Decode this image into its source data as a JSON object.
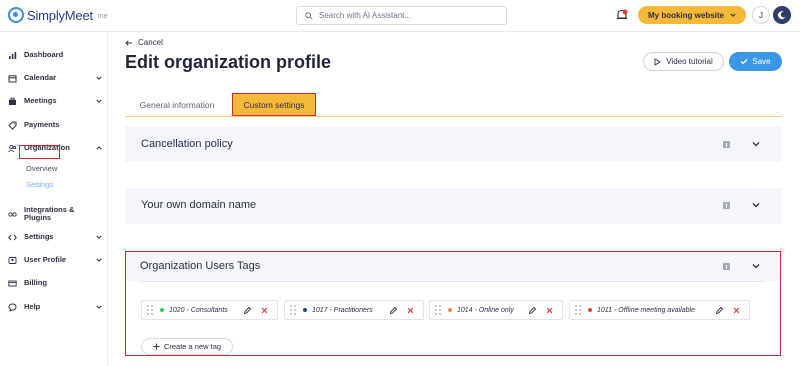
{
  "brand": {
    "name": "SimplyMeet",
    "suffix": "me"
  },
  "search": {
    "placeholder": "Search with AI Assistant..."
  },
  "header": {
    "booking_button": "My booking website",
    "avatar_initial": "J"
  },
  "sidebar": {
    "items": [
      {
        "label": "Dashboard",
        "icon": "chart-icon"
      },
      {
        "label": "Calendar",
        "icon": "calendar-icon"
      },
      {
        "label": "Meetings",
        "icon": "briefcase-icon"
      },
      {
        "label": "Payments",
        "icon": "tag-icon"
      },
      {
        "label": "Organization",
        "icon": "users-icon"
      },
      {
        "label": "Integrations & Plugins",
        "icon": "plug-icon"
      },
      {
        "label": "Settings",
        "icon": "code-icon"
      },
      {
        "label": "User Profile",
        "icon": "user-icon"
      },
      {
        "label": "Billing",
        "icon": "card-icon"
      },
      {
        "label": "Help",
        "icon": "chat-icon"
      }
    ],
    "organization_sub": [
      {
        "label": "Overview"
      },
      {
        "label": "Settings"
      }
    ]
  },
  "main": {
    "cancel_label": "Cancel",
    "title": "Edit organization profile",
    "video_tutorial_label": "Video tutorial",
    "save_label": "Save",
    "tabs": [
      {
        "label": "General information"
      },
      {
        "label": "Custom settings"
      }
    ],
    "panels": [
      {
        "title": "Cancellation policy"
      },
      {
        "title": "Your own domain name"
      },
      {
        "title": "Organization Users Tags"
      }
    ],
    "tags": [
      {
        "label": "1020 - Consultants",
        "color": "#3ec46d"
      },
      {
        "label": "1017 - Practitioners",
        "color": "#2f3d8a"
      },
      {
        "label": "1014 - Online only",
        "color": "#f08a3c"
      },
      {
        "label": "1011 - Offline meeting available",
        "color": "#e23c3c"
      }
    ],
    "create_tag_label": "Create a new tag"
  },
  "colors": {
    "accent": "#f5b93a",
    "primary": "#3a97e6",
    "highlight": "#d9262c"
  }
}
